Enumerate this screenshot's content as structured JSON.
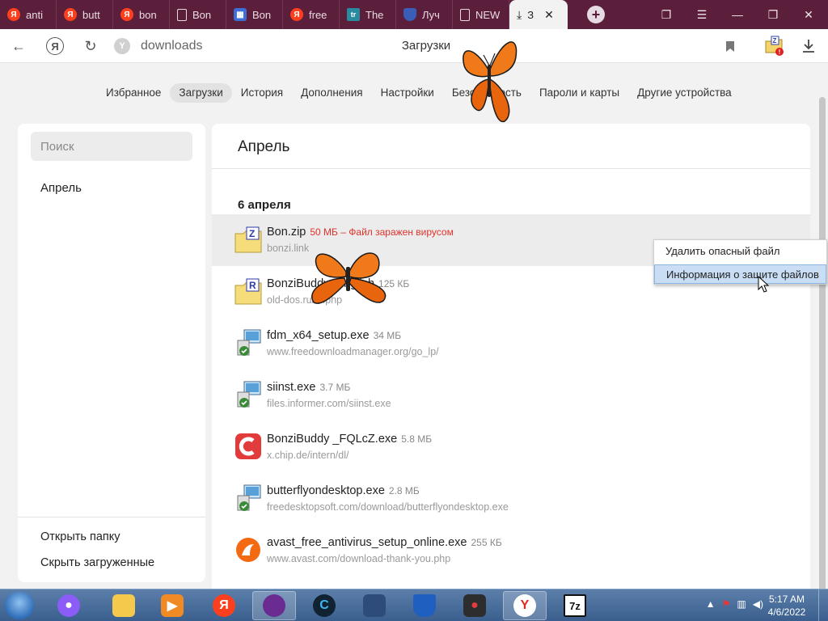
{
  "tabs": [
    {
      "title": "anti",
      "favicon": "yandex-icon"
    },
    {
      "title": "butt",
      "favicon": "yandex-icon"
    },
    {
      "title": "bon",
      "favicon": "yandex-icon"
    },
    {
      "title": "Bon",
      "favicon": "document-icon"
    },
    {
      "title": "Bon",
      "favicon": "grid-icon"
    },
    {
      "title": "free",
      "favicon": "yandex-icon"
    },
    {
      "title": "The",
      "favicon": "tr-icon"
    },
    {
      "title": "Луч",
      "favicon": "shield-icon"
    },
    {
      "title": "NEW",
      "favicon": "document-icon"
    }
  ],
  "active_tab": {
    "title": "З",
    "favicon": "download-icon"
  },
  "address": {
    "url": "downloads",
    "page_title": "Загрузки"
  },
  "settings_nav": [
    "Избранное",
    "Загрузки",
    "История",
    "Дополнения",
    "Настройки",
    "Безопасность",
    "Пароли и карты",
    "Другие устройства"
  ],
  "sidebar": {
    "search_placeholder": "Поиск",
    "month": "Апрель",
    "open_folder": "Открыть папку",
    "hide_downloaded": "Скрыть загруженные"
  },
  "main": {
    "header": "Апрель",
    "date_heading": "6 апреля",
    "downloads": [
      {
        "name": "Bon.zip",
        "size": "50 МБ – Файл заражен вирусом",
        "warning": true,
        "source": "bonzi.link",
        "icon": "zip-archive-icon"
      },
      {
        "name": "BonziBuddy_English",
        "size": "125 КБ",
        "warning": false,
        "source": "old-dos.ru/dl.php",
        "icon": "rar-archive-icon"
      },
      {
        "name": "fdm_x64_setup.exe",
        "size": "34 МБ",
        "warning": false,
        "source": "www.freedownloadmanager.org/go_lp/",
        "icon": "installer-icon"
      },
      {
        "name": "siinst.exe",
        "size": "3.7 МБ",
        "warning": false,
        "source": "files.informer.com/siinst.exe",
        "icon": "installer-icon"
      },
      {
        "name": "BonziBuddy _FQLcZ.exe",
        "size": "5.8 МБ",
        "warning": false,
        "source": "x.chip.de/intern/dl/",
        "icon": "chip-icon"
      },
      {
        "name": "butterflyondesktop.exe",
        "size": "2.8 МБ",
        "warning": false,
        "source": "freedesktopsoft.com/download/butterflyondesktop.exe",
        "icon": "installer-icon"
      },
      {
        "name": "avast_free_antivirus_setup_online.exe",
        "size": "255 КБ",
        "warning": false,
        "source": "www.avast.com/download-thank-you.php",
        "icon": "avast-icon"
      }
    ]
  },
  "context_menu": {
    "items": [
      "Удалить опасный файл",
      "Информация о защите файлов"
    ]
  },
  "taskbar": {
    "apps": [
      "alice-icon",
      "explorer-icon",
      "media-player-icon",
      "yandex-icon",
      "browser-icon",
      "ccleaner-icon",
      "remote-icon",
      "security-icon",
      "screen-recorder-icon",
      "yandex-browser-icon",
      "7zip-icon"
    ],
    "time": "5:17 AM",
    "date": "4/6/2022"
  },
  "colors": {
    "tabstrip": "#5b1f3c",
    "warning": "#e0322b",
    "menu_highlight": "#c9def5"
  }
}
